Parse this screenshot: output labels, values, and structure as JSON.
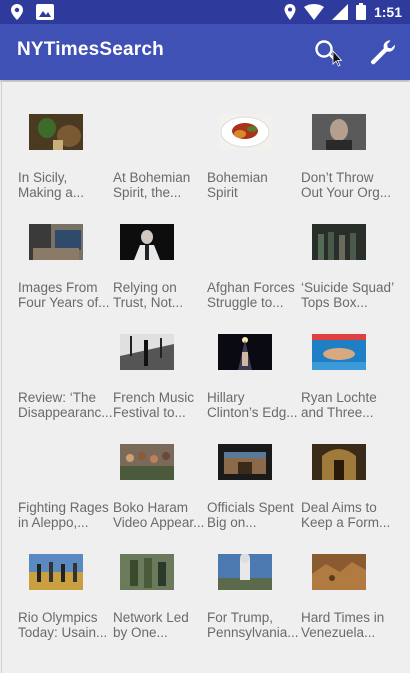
{
  "status_bar": {
    "time": "1:51"
  },
  "app_bar": {
    "title": "NYTimesSearch"
  },
  "articles": [
    {
      "headline": "In Sicily,\nMaking a..."
    },
    {
      "headline": "At Bohemian\nSpirit, the..."
    },
    {
      "headline": "Bohemian\nSpirit"
    },
    {
      "headline": "Don’t Throw\nOut Your Org..."
    },
    {
      "headline": "Images From\nFour Years of..."
    },
    {
      "headline": "Relying on\nTrust, Not..."
    },
    {
      "headline": "Afghan Forces\nStruggle to..."
    },
    {
      "headline": "‘Suicide Squad’\nTops Box..."
    },
    {
      "headline": "Review: ‘The\nDisappearanc..."
    },
    {
      "headline": "French Music\nFestival to..."
    },
    {
      "headline": "Hillary\nClinton’s Edg..."
    },
    {
      "headline": "Ryan Lochte\nand Three..."
    },
    {
      "headline": "Fighting Rages\nin Aleppo,..."
    },
    {
      "headline": "Boko Haram\nVideo Appear..."
    },
    {
      "headline": "Officials Spent\nBig on..."
    },
    {
      "headline": "Deal Aims to\nKeep a Form..."
    },
    {
      "headline": "Rio Olympics\nToday: Usain..."
    },
    {
      "headline": "Network Led\nby One..."
    },
    {
      "headline": "For Trump,\nPennsylvania..."
    },
    {
      "headline": "Hard Times in\nVenezuela..."
    }
  ],
  "colors": {
    "primary": "#3f51b5",
    "primary_dark": "#2e3a9c",
    "background": "#efefef",
    "headline_text": "#6a6a6a"
  }
}
